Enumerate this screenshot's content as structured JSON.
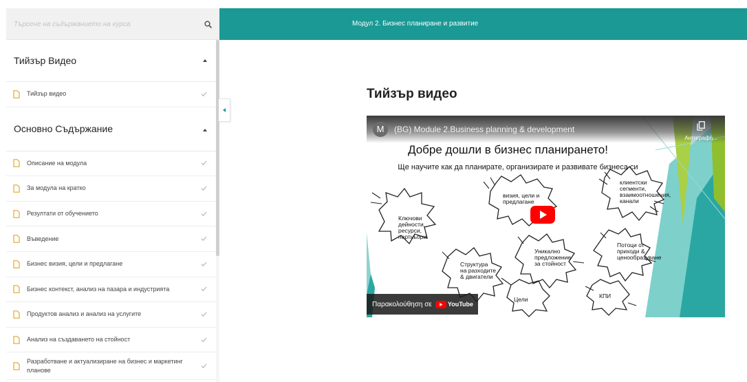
{
  "search": {
    "placeholder": "Търсене на съдържанието на курса"
  },
  "header": {
    "breadcrumb": "Модул 2. Бизнес планиране и развитие"
  },
  "sidebar": {
    "sections": [
      {
        "title": "Тийзър Видео",
        "lessons": [
          "Тийзър видео"
        ]
      },
      {
        "title": "Основно Съдържание",
        "lessons": [
          "Описание на модула",
          "За модула на кратко",
          "Резултати от обучението",
          "Въведение",
          "Бизнес визия, цели и предлагане",
          "Бизнес контекст, анализ на пазара и индустрията",
          "Продуктов анализ и анализ на услугите",
          "Анализ на създаването на стойност",
          "Разработване и актуализиране на бизнес и маркетинг планове"
        ]
      }
    ]
  },
  "main": {
    "lesson_title": "Тийзър видео"
  },
  "video": {
    "channel_initial": "M",
    "title": "(BG) Module 2.Business planning & development",
    "copy_label": "Антиграфή...",
    "slide_heading": "Добре дошли в бизнес планирането!",
    "slide_subheading": "Ще научите как да планирате, организирате и развивате бизнеса си",
    "bursts": [
      "Ключови дейности, ресурси, партньори",
      "визия, цели и предлагане",
      "клиентски сегменти, взаимоотношения, канали",
      "Уникално предложение за стойност",
      "Структура на разходите & двигатели",
      "Потоци от приходи & ценообразуване",
      "Цели",
      "КПИ"
    ],
    "watch_on": "Παρακολούθηση σε",
    "youtube_label": "YouTube"
  },
  "colors": {
    "accent": "#1a9995",
    "youtube_red": "#ff0000"
  }
}
